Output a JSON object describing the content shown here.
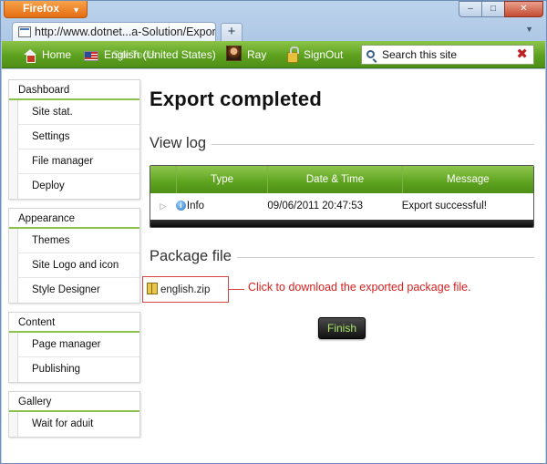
{
  "browser": {
    "menu_label": "Firefox",
    "tab_title": "http://www.dotnet...a-Solution/Export",
    "new_tab": "+",
    "window_controls": {
      "minimize": "–",
      "maximize": "□",
      "close": "✕"
    }
  },
  "navbar": {
    "home": "Home",
    "language": "English (United States)",
    "language_overlap": "SiteTools",
    "user": "Ray",
    "signout": "SignOut",
    "search_placeholder": "Search this site",
    "search_clear": "✖"
  },
  "sidebar": {
    "groups": [
      {
        "title": "Dashboard",
        "items": [
          "Site stat.",
          "Settings",
          "File manager",
          "Deploy"
        ]
      },
      {
        "title": "Appearance",
        "items": [
          "Themes",
          "Site Logo and icon",
          "Style Designer"
        ]
      },
      {
        "title": "Content",
        "items": [
          "Page manager",
          "Publishing"
        ]
      },
      {
        "title": "Gallery",
        "items": [
          "Wait for aduit"
        ]
      }
    ]
  },
  "main": {
    "heading": "Export completed",
    "view_log_title": "View log",
    "log_table": {
      "columns": [
        "",
        "Type",
        "Date & Time",
        "Message"
      ],
      "rows": [
        {
          "expander": "▷",
          "type": "Info",
          "datetime": "09/06/2011 20:47:53",
          "message": "Export successful!"
        }
      ]
    },
    "package_title": "Package file",
    "package_file": "english.zip",
    "callout": "Click to download the exported package file.",
    "finish_label": "Finish"
  },
  "colors": {
    "nav_green": "#5da11f",
    "accent_line": "#8cc14e",
    "callout_red": "#d62020",
    "finish_text": "#a9e86a"
  },
  "icons": [
    "home-icon",
    "flag-icon",
    "avatar-icon",
    "lock-icon",
    "search-icon",
    "info-icon",
    "zip-file-icon"
  ]
}
